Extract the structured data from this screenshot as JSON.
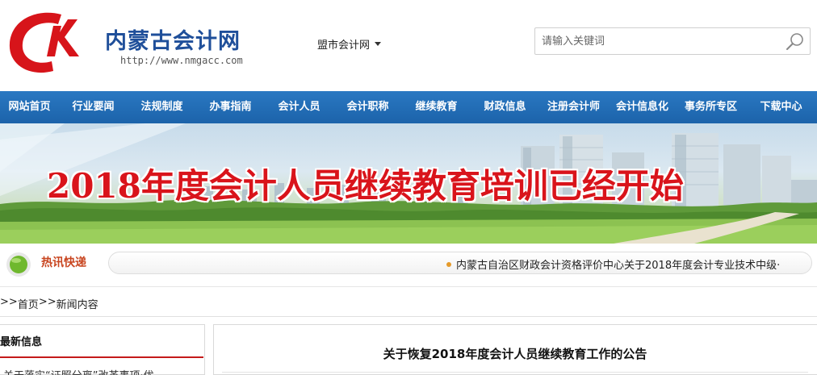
{
  "header": {
    "site_name": "内蒙古会计网",
    "site_url": "http://www.nmgacc.com",
    "city_select": "盟市会计网",
    "search": {
      "placeholder": "请输入关键词"
    }
  },
  "nav": {
    "items": [
      {
        "label": "网站首页"
      },
      {
        "label": "行业要闻"
      },
      {
        "label": "法规制度"
      },
      {
        "label": "办事指南"
      },
      {
        "label": "会计人员"
      },
      {
        "label": "会计职称"
      },
      {
        "label": "继续教育"
      },
      {
        "label": "财政信息"
      },
      {
        "label": "注册会计师"
      },
      {
        "label": "会计信息化"
      },
      {
        "label": "事务所专区"
      },
      {
        "label": "下载中心"
      }
    ]
  },
  "banner": {
    "headline": "2018年度会计人员继续教育培训已经开始"
  },
  "ticker": {
    "label": "热讯快递",
    "item": "内蒙古自治区财政会计资格评价中心关于2018年度会计专业技术中级·"
  },
  "breadcrumb": {
    "prefix": ">>",
    "home": "首页",
    "separator": ">>",
    "current": "新闻内容"
  },
  "sidebar": {
    "title": "最新信息",
    "first_item": "关于落实“证照分离”改革事项·优..."
  },
  "article": {
    "title": "关于恢复2018年度会计人员继续教育工作的公告"
  },
  "colors": {
    "brand_blue": "#1f4f9a",
    "nav_blue": "#2370b8",
    "logo_red": "#d7141a",
    "headline_red": "#d9141b",
    "sidebar_rule": "#c41a1a"
  }
}
